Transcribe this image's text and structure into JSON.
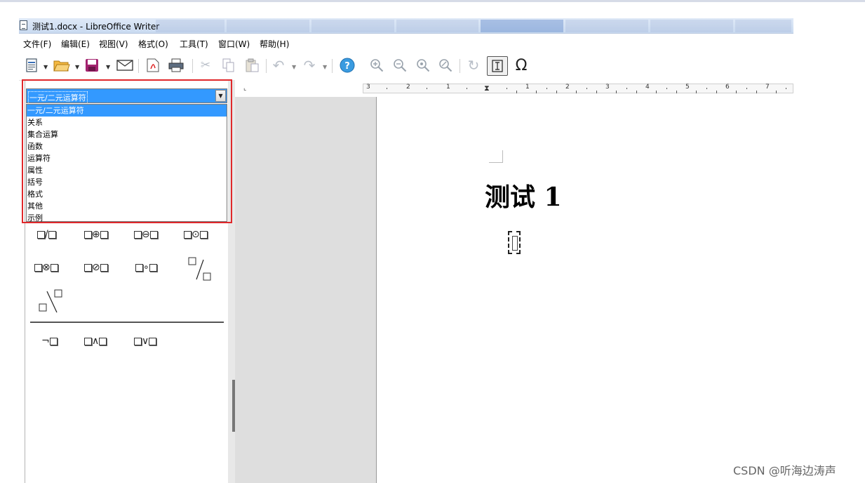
{
  "window": {
    "title": "测试1.docx - LibreOffice Writer"
  },
  "menubar": {
    "items": [
      "文件(F)",
      "编辑(E)",
      "视图(V)",
      "格式(O)",
      "工具(T)",
      "窗口(W)",
      "帮助(H)"
    ]
  },
  "toolbar": {
    "icons": [
      "new-document-icon",
      "open-folder-icon",
      "save-icon",
      "email-icon",
      "export-pdf-icon",
      "print-icon",
      "cut-icon",
      "copy-icon",
      "paste-icon",
      "undo-icon",
      "redo-icon",
      "help-icon",
      "zoom-in-icon",
      "zoom-out-icon",
      "zoom-100-icon",
      "zoom-fit-icon",
      "refresh-icon",
      "formula-cursor-icon",
      "omega-icon"
    ]
  },
  "elements_panel": {
    "combo_value": "一元/二元运算符",
    "options": [
      "一元/二元运算符",
      "关系",
      "集合运算",
      "函数",
      "运算符",
      "属性",
      "括号",
      "格式",
      "其他",
      "示例"
    ],
    "selected_index": 0,
    "symbol_rows": [
      [
        "/",
        "⊕",
        "⊖",
        "⊙"
      ],
      [
        "⊗",
        "⊘",
        "∘"
      ],
      [
        "¬",
        "∧",
        "∨"
      ]
    ]
  },
  "ruler": {
    "labels": [
      "3",
      "2",
      "1",
      "1",
      "2",
      "3",
      "4",
      "5",
      "6",
      "7"
    ]
  },
  "document": {
    "heading": "测试 1"
  },
  "watermark": "CSDN @听海边涛声",
  "colors": {
    "highlight": "#3399ff",
    "annotation_border": "#e0282b",
    "title_bar": "#dfe9f7"
  }
}
